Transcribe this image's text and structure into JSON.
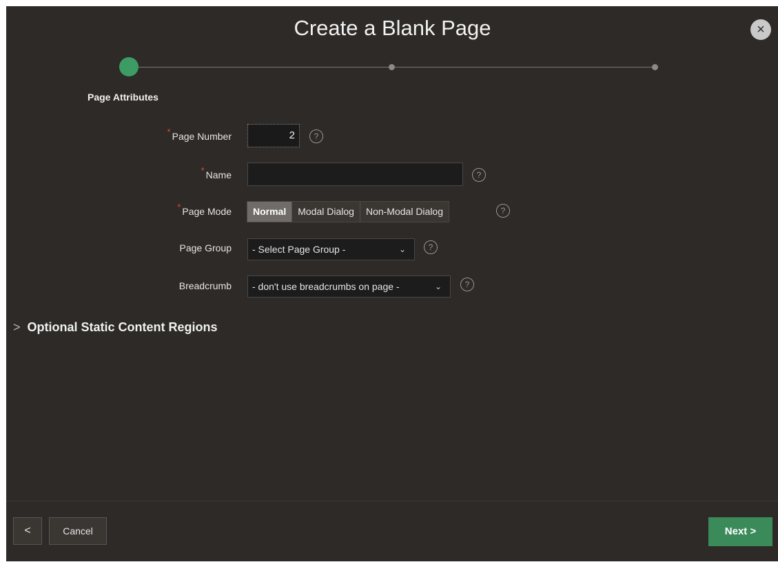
{
  "dialog": {
    "title": "Create a Blank Page",
    "close_glyph": "×"
  },
  "wizard": {
    "step_label": "Page Attributes"
  },
  "form": {
    "page_number": {
      "label": "Page Number",
      "value": "2",
      "required": true
    },
    "name": {
      "label": "Name",
      "value": "",
      "required": true
    },
    "page_mode": {
      "label": "Page Mode",
      "options": [
        "Normal",
        "Modal Dialog",
        "Non-Modal Dialog"
      ],
      "selected": "Normal",
      "required": true
    },
    "page_group": {
      "label": "Page Group",
      "value": "- Select Page Group -"
    },
    "breadcrumb": {
      "label": "Breadcrumb",
      "value": "- don't use breadcrumbs on page -"
    },
    "help_glyph": "?",
    "required_glyph": "*"
  },
  "section": {
    "arrow": ">",
    "label": "Optional Static Content Regions"
  },
  "footer": {
    "back_glyph": "<",
    "cancel_label": "Cancel",
    "next_label": "Next >"
  },
  "colors": {
    "background": "#2d2a27",
    "accent_green": "#3a8a5a",
    "step_active": "#3d9c64",
    "required": "#e0483a"
  }
}
